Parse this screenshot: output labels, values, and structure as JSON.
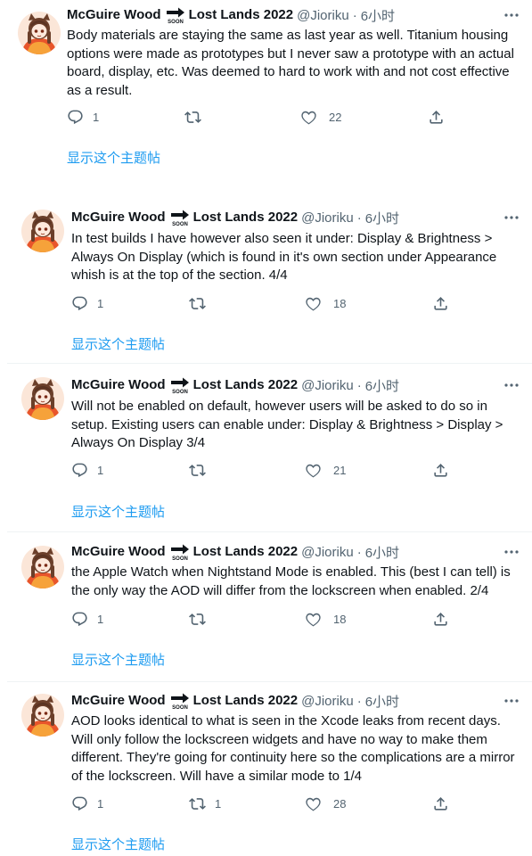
{
  "author": {
    "name_part1": "McGuire Wood",
    "name_part2": "Lost Lands 2022",
    "handle": "@Jioriku",
    "dot": "·",
    "time": "6小时"
  },
  "thread_link_label": "显示这个主题帖",
  "colors": {
    "accent": "#1d9bf0",
    "secondary": "#536471",
    "text": "#0f1419",
    "divider": "#eff3f4"
  },
  "icons": {
    "reply": "reply-icon",
    "retweet": "retweet-icon",
    "like": "heart-icon",
    "share": "share-icon",
    "more": "more-icon",
    "soon": "soon-arrow-emoji"
  },
  "tweets": [
    {
      "lines": [
        "Body materials are staying the same as last year as well. Titanium housing",
        "options were made as prototypes but I never saw a prototype with an actual",
        "board, display, etc. Was deemed to hard to work with and not cost effective",
        "as a result."
      ],
      "replies": "1",
      "retweets": "",
      "likes": "22"
    },
    {
      "lines": [
        "In test builds I have however also seen it under: Display & Brightness >",
        "Always On Display (which is found in it's own section under Appearance",
        "whish is at the top of the section. 4/4"
      ],
      "replies": "1",
      "retweets": "",
      "likes": "18"
    },
    {
      "lines": [
        "Will not be enabled on default, however users will be asked to do so in",
        "setup. Existing users can enable under: Display & Brightness > Display >",
        "Always On Display 3/4"
      ],
      "replies": "1",
      "retweets": "",
      "likes": "21"
    },
    {
      "lines": [
        "the Apple Watch when Nightstand Mode is enabled. This (best I can tell) is",
        "the only way the AOD will differ from the lockscreen when enabled. 2/4"
      ],
      "replies": "1",
      "retweets": "",
      "likes": "18"
    },
    {
      "lines": [
        "AOD looks identical to what is seen in the Xcode leaks from recent days.",
        "Will only follow the lockscreen widgets and have no way to make them",
        "different. They're going for continuity here so the complications are a mirror",
        "of the lockscreen. Will have a similar mode  to 1/4"
      ],
      "replies": "1",
      "retweets": "1",
      "likes": "28"
    }
  ]
}
